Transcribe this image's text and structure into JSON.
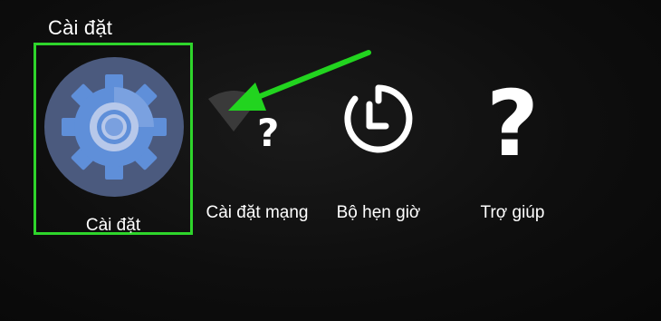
{
  "header": {
    "title": "Cài đặt"
  },
  "menu": {
    "items": [
      {
        "label": "Cài đặt",
        "icon": "gear-icon",
        "selected": true
      },
      {
        "label": "Cài đặt mạng",
        "icon": "wifi-question-icon",
        "selected": false
      },
      {
        "label": "Bộ hẹn giờ",
        "icon": "timer-icon",
        "selected": false
      },
      {
        "label": "Trợ giúp",
        "icon": "help-icon",
        "selected": false
      }
    ]
  },
  "annotation": {
    "arrow_color": "#22d41f",
    "selection_color": "#2ed52b"
  }
}
